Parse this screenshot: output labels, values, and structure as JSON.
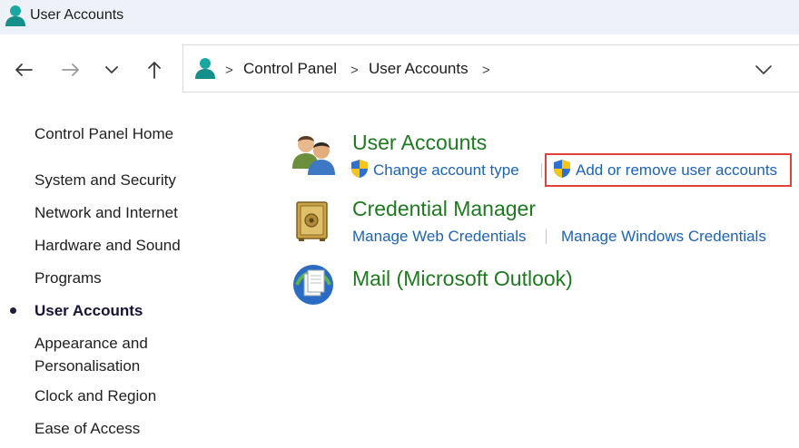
{
  "window": {
    "title": "User Accounts"
  },
  "nav": {
    "back_icon": "arrow-left-icon",
    "forward_icon": "arrow-right-icon",
    "recent_icon": "chevron-down-icon",
    "up_icon": "arrow-up-icon"
  },
  "address": {
    "crumbs": [
      "Control Panel",
      "User Accounts"
    ],
    "separator": ">"
  },
  "sidebar": {
    "home": "Control Panel Home",
    "items": [
      {
        "label": "System and Security",
        "active": false
      },
      {
        "label": "Network and Internet",
        "active": false
      },
      {
        "label": "Hardware and Sound",
        "active": false
      },
      {
        "label": "Programs",
        "active": false
      },
      {
        "label": "User Accounts",
        "active": true
      },
      {
        "label": "Appearance and\nPersonalisation",
        "active": false
      },
      {
        "label": "Clock and Region",
        "active": false
      },
      {
        "label": "Ease of Access",
        "active": false
      }
    ]
  },
  "main": {
    "categories": [
      {
        "title": "User Accounts",
        "icon": "users-icon",
        "tasks": [
          {
            "label": "Change account type",
            "shield": true
          },
          {
            "label": "Add or remove user accounts",
            "shield": true,
            "highlighted": true
          }
        ]
      },
      {
        "title": "Credential Manager",
        "icon": "vault-icon",
        "tasks": [
          {
            "label": "Manage Web Credentials",
            "shield": false
          },
          {
            "label": "Manage Windows Credentials",
            "shield": false
          }
        ]
      },
      {
        "title": "Mail (Microsoft Outlook)",
        "icon": "mail-icon",
        "tasks": []
      }
    ]
  },
  "colors": {
    "category_title": "#1d7a1f",
    "task_link": "#1c63b7",
    "highlight": "#e0413a",
    "titlebar_bg": "#eef2f8"
  }
}
